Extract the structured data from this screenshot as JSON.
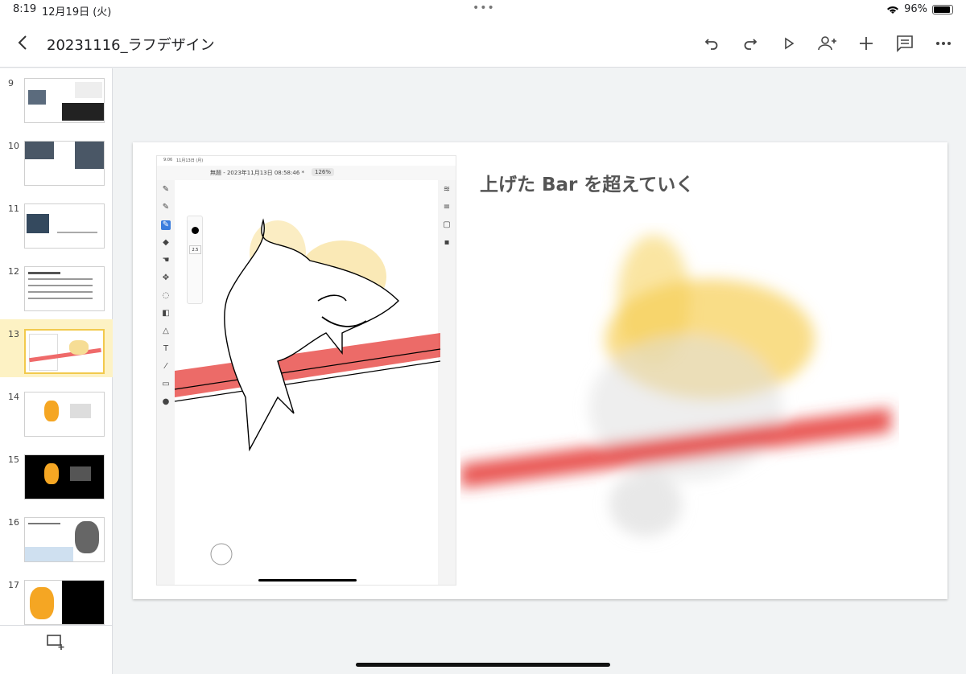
{
  "status_bar": {
    "time": "8:19",
    "date": "12月19日 (火)",
    "battery": "96%"
  },
  "header": {
    "title": "20231116_ラフデザイン"
  },
  "toolbar_icons": [
    "undo-icon",
    "redo-icon",
    "present-icon",
    "share-icon",
    "add-icon",
    "comment-icon",
    "more-icon"
  ],
  "slides": [
    {
      "number": "9"
    },
    {
      "number": "10"
    },
    {
      "number": "11"
    },
    {
      "number": "12"
    },
    {
      "number": "13",
      "selected": true
    },
    {
      "number": "14"
    },
    {
      "number": "15"
    },
    {
      "number": "16"
    },
    {
      "number": "17"
    }
  ],
  "slide": {
    "title": "上げた Bar を超えていく",
    "inner_app": {
      "time": "9:06",
      "date": "11月13日 (月)",
      "doc_title": "無題 - 2023年11月13日 08:58:46 *",
      "zoom": "126%",
      "brush_size": "2.5"
    }
  },
  "colors": {
    "accent": "#f2c94c",
    "red_brush": "#e53935",
    "yellow_brush": "#f5c842"
  }
}
